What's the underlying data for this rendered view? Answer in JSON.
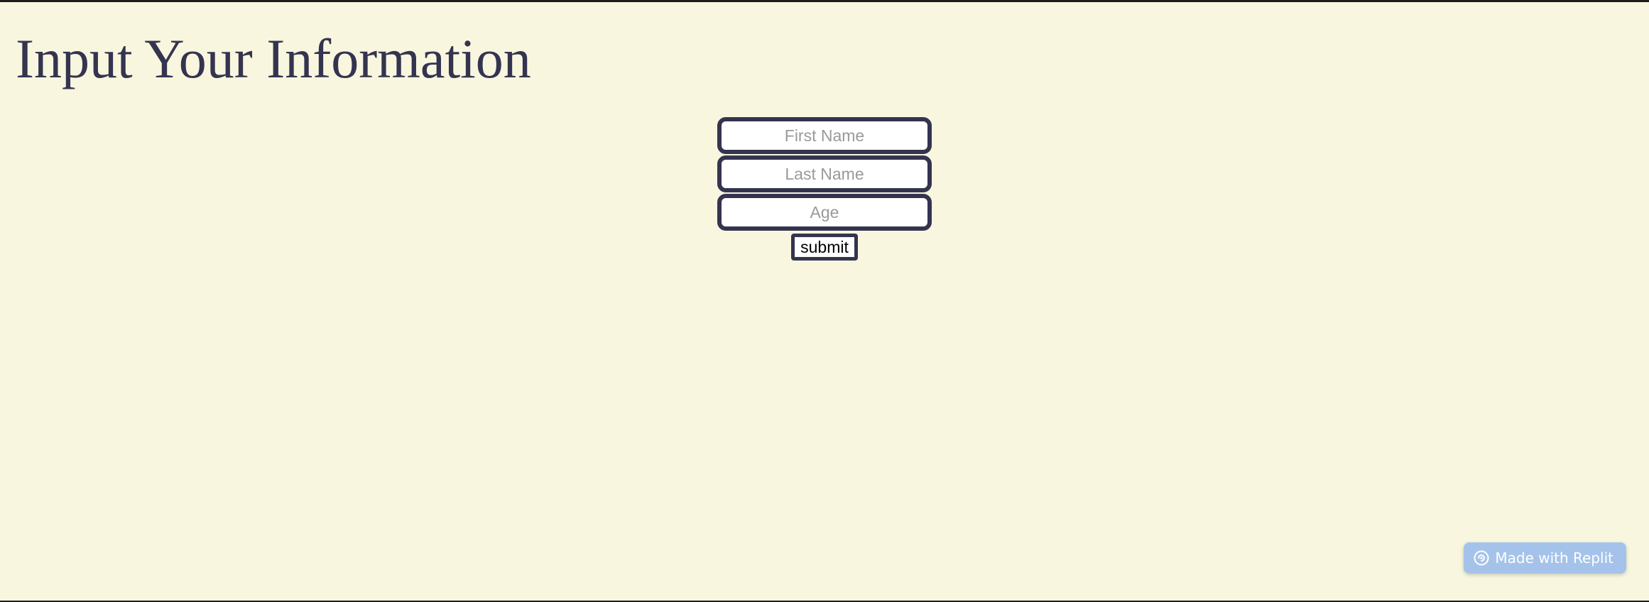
{
  "page": {
    "title": "Input Your Information"
  },
  "form": {
    "first_name": {
      "placeholder": "First Name",
      "value": ""
    },
    "last_name": {
      "placeholder": "Last Name",
      "value": ""
    },
    "age": {
      "placeholder": "Age",
      "value": ""
    },
    "submit_label": "submit"
  },
  "badge": {
    "label": "Made with Replit",
    "icon": "replit-logo-icon"
  },
  "colors": {
    "background": "#f8f6de",
    "accent": "#343450",
    "badge": "#a5c3ea"
  }
}
